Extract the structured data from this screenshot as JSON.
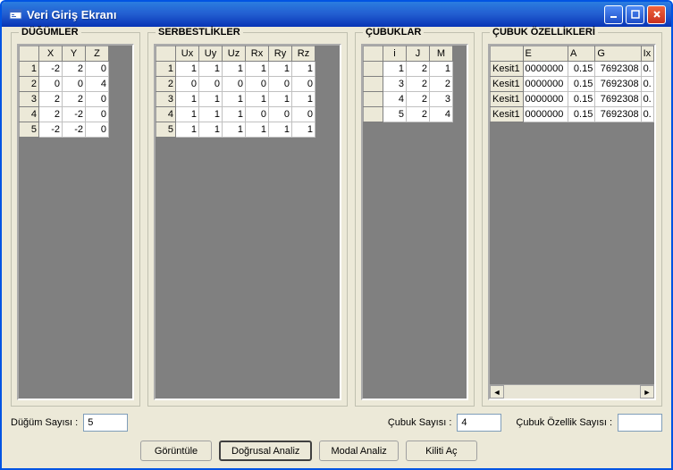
{
  "window": {
    "title": "Veri Giriş Ekranı"
  },
  "groups": {
    "dugumler": {
      "title": "DÜĞÜMLER",
      "columns": [
        "X",
        "Y",
        "Z"
      ],
      "rows": [
        {
          "n": "1",
          "X": "-2",
          "Y": "2",
          "Z": "0"
        },
        {
          "n": "2",
          "X": "0",
          "Y": "0",
          "Z": "4"
        },
        {
          "n": "3",
          "X": "2",
          "Y": "2",
          "Z": "0"
        },
        {
          "n": "4",
          "X": "2",
          "Y": "-2",
          "Z": "0"
        },
        {
          "n": "5",
          "X": "-2",
          "Y": "-2",
          "Z": "0"
        }
      ]
    },
    "serbestlikler": {
      "title": "SERBESTLİKLER",
      "columns": [
        "Ux",
        "Uy",
        "Uz",
        "Rx",
        "Ry",
        "Rz"
      ],
      "rows": [
        {
          "n": "1",
          "vals": [
            "1",
            "1",
            "1",
            "1",
            "1",
            "1"
          ]
        },
        {
          "n": "2",
          "vals": [
            "0",
            "0",
            "0",
            "0",
            "0",
            "0"
          ]
        },
        {
          "n": "3",
          "vals": [
            "1",
            "1",
            "1",
            "1",
            "1",
            "1"
          ]
        },
        {
          "n": "4",
          "vals": [
            "1",
            "1",
            "1",
            "0",
            "0",
            "0"
          ]
        },
        {
          "n": "5",
          "vals": [
            "1",
            "1",
            "1",
            "1",
            "1",
            "1"
          ]
        }
      ]
    },
    "cubuklar": {
      "title": "ÇUBUKLAR",
      "columns": [
        "i",
        "J",
        "M"
      ],
      "rows": [
        {
          "n": "",
          "vals": [
            "1",
            "2",
            "1"
          ]
        },
        {
          "n": "",
          "vals": [
            "3",
            "2",
            "2"
          ]
        },
        {
          "n": "",
          "vals": [
            "4",
            "2",
            "3"
          ]
        },
        {
          "n": "",
          "vals": [
            "5",
            "2",
            "4"
          ]
        }
      ]
    },
    "ozellikler": {
      "title": "ÇUBUK ÖZELLİKLERİ",
      "columns": [
        "E",
        "A",
        "G",
        "Ix"
      ],
      "rows": [
        {
          "n": "Kesit1",
          "E": "0000000",
          "A": "0.15",
          "G": "7692308",
          "Ix": "0."
        },
        {
          "n": "Kesit1",
          "E": "0000000",
          "A": "0.15",
          "G": "7692308",
          "Ix": "0."
        },
        {
          "n": "Kesit1",
          "E": "0000000",
          "A": "0.15",
          "G": "7692308",
          "Ix": "0."
        },
        {
          "n": "Kesit1",
          "E": "0000000",
          "A": "0.15",
          "G": "7692308",
          "Ix": "0."
        }
      ]
    }
  },
  "bottom": {
    "dugum_sayisi_label": "Düğüm Sayısı :",
    "dugum_sayisi_value": "5",
    "cubuk_sayisi_label": "Çubuk Sayısı :",
    "cubuk_sayisi_value": "4",
    "cubuk_ozellik_label": "Çubuk Özellik Sayısı :",
    "cubuk_ozellik_value": ""
  },
  "buttons": {
    "goruntule": "Görüntüle",
    "dogrusal": "Doğrusal Analiz",
    "modal": "Modal Analiz",
    "kilidi_ac": "Kiliti Aç"
  }
}
